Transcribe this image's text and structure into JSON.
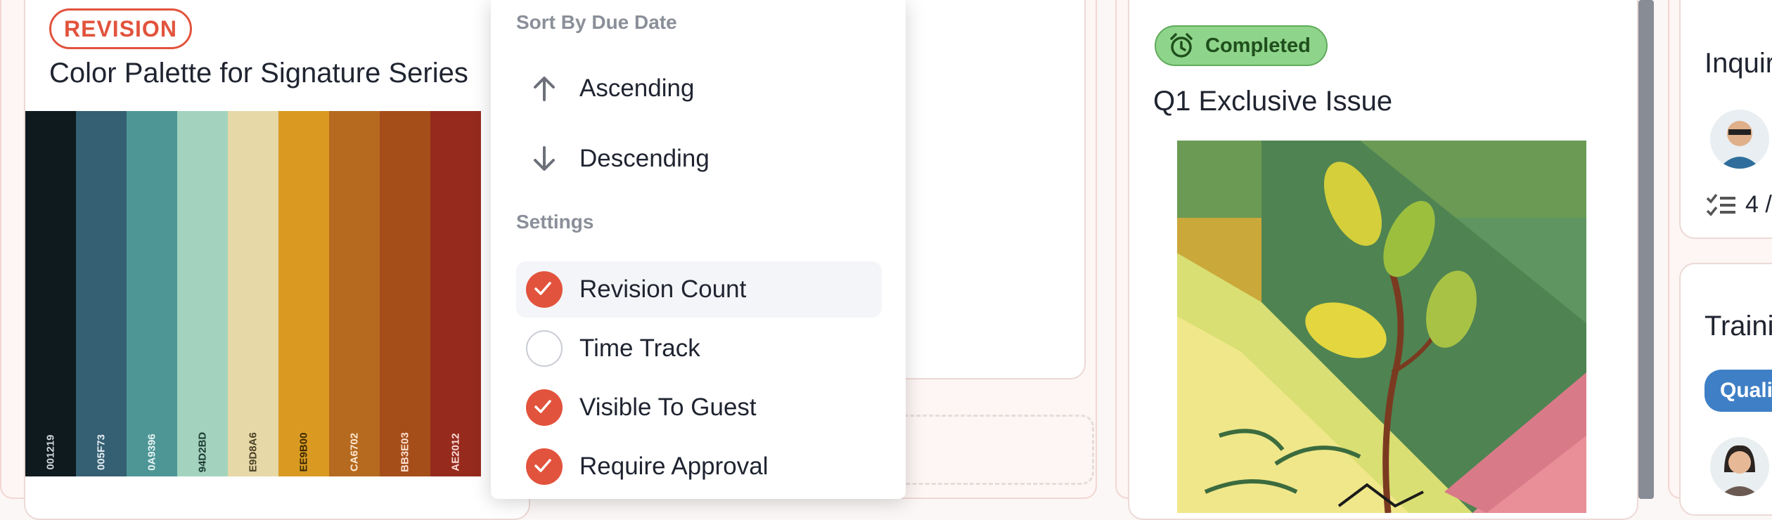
{
  "card_palette": {
    "tag": "REVISION",
    "title": "Color Palette for Signature Series",
    "swatches": [
      {
        "hex": "#0E1A1E",
        "label": "001219",
        "text": "#cfd6d8"
      },
      {
        "hex": "#355F73",
        "label": "005F73",
        "text": "#e6eef2"
      },
      {
        "hex": "#4E9696",
        "label": "0A9396",
        "text": "#e6f3f3"
      },
      {
        "hex": "#A3D3BE",
        "label": "94D2BD",
        "text": "#1b3a33"
      },
      {
        "hex": "#E6D8A7",
        "label": "E9D8A6",
        "text": "#4a4126"
      },
      {
        "hex": "#DA9A22",
        "label": "EE9B00",
        "text": "#3b2800"
      },
      {
        "hex": "#B66A20",
        "label": "CA6702",
        "text": "#fde9d1"
      },
      {
        "hex": "#A54E1A",
        "label": "BB3E03",
        "text": "#fde3d3"
      },
      {
        "hex": "#952A1D",
        "label": "AE2012",
        "text": "#fbdcd8"
      }
    ]
  },
  "menu": {
    "sort_heading": "Sort By Due Date",
    "sort_items": [
      {
        "label": "Ascending",
        "icon": "arrow-up-icon"
      },
      {
        "label": "Descending",
        "icon": "arrow-down-icon"
      }
    ],
    "settings_heading": "Settings",
    "settings_items": [
      {
        "label": "Revision Count",
        "checked": true
      },
      {
        "label": "Time Track",
        "checked": false
      },
      {
        "label": "Visible To Guest",
        "checked": true
      },
      {
        "label": "Require Approval",
        "checked": true
      }
    ]
  },
  "card_issue": {
    "badge": "Completed",
    "title": "Q1 Exclusive Issue"
  },
  "right_column": {
    "card1_title": "Inquir",
    "card1_checklist": "4 /",
    "card2_title": "Trainin",
    "card2_pill": "Quali"
  },
  "colors": {
    "accent": "#e2533d",
    "completed_bg": "#8fd48b",
    "pill_blue": "#3f7fc6"
  }
}
